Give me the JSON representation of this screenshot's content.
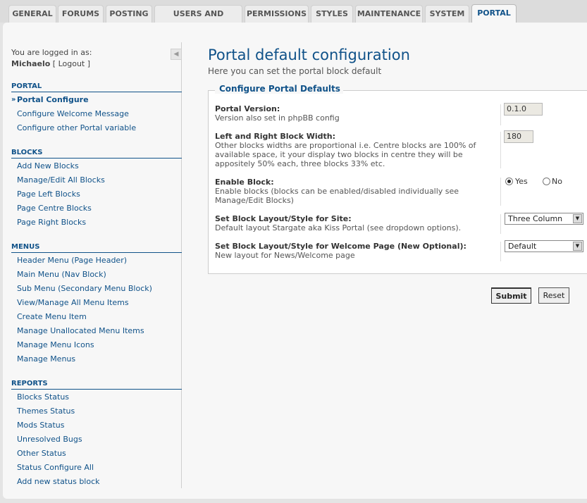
{
  "tabs": [
    {
      "label": "GENERAL"
    },
    {
      "label": "FORUMS"
    },
    {
      "label": "POSTING"
    },
    {
      "label": "USERS AND GROUPS"
    },
    {
      "label": "PERMISSIONS"
    },
    {
      "label": "STYLES"
    },
    {
      "label": "MAINTENANCE"
    },
    {
      "label": "SYSTEM"
    },
    {
      "label": "PORTAL"
    }
  ],
  "login": {
    "label": "You are logged in as:",
    "username": "Michaelo",
    "logout_open": "[",
    "logout": "Logout",
    "logout_close": "]"
  },
  "collapse_icon": "◀",
  "sidebar": {
    "portal": {
      "heading": "PORTAL",
      "items": [
        {
          "label": "Portal Configure"
        },
        {
          "label": "Configure Welcome Message"
        },
        {
          "label": "Configure other Portal variable"
        }
      ]
    },
    "blocks": {
      "heading": "BLOCKS",
      "items": [
        {
          "label": "Add New Blocks"
        },
        {
          "label": "Manage/Edit All Blocks"
        },
        {
          "label": "Page Left Blocks"
        },
        {
          "label": "Page Centre Blocks"
        },
        {
          "label": "Page Right Blocks"
        }
      ]
    },
    "menus": {
      "heading": "MENUS",
      "items": [
        {
          "label": "Header Menu (Page Header)"
        },
        {
          "label": "Main Menu (Nav Block)"
        },
        {
          "label": "Sub Menu (Secondary Menu Block)"
        },
        {
          "label": "View/Manage All Menu Items"
        },
        {
          "label": "Create Menu Item"
        },
        {
          "label": "Manage Unallocated Menu Items"
        },
        {
          "label": "Manage Menu Icons"
        },
        {
          "label": "Manage Menus"
        }
      ]
    },
    "reports": {
      "heading": "REPORTS",
      "items": [
        {
          "label": "Blocks Status"
        },
        {
          "label": "Themes Status"
        },
        {
          "label": "Mods Status"
        },
        {
          "label": "Unresolved Bugs"
        },
        {
          "label": "Other Status"
        },
        {
          "label": "Status Configure All"
        },
        {
          "label": "Add new status block"
        }
      ]
    }
  },
  "page": {
    "title": "Portal default configuration",
    "subtitle": "Here you can set the portal block default"
  },
  "form": {
    "legend": "Configure Portal Defaults",
    "version": {
      "title": "Portal Version:",
      "desc": "Version also set in phpBB config",
      "value": "0.1.0"
    },
    "width": {
      "title": "Left and Right Block Width:",
      "desc": "Other blocks widths are proportional i.e. Centre blocks are 100% of available space, it your display two blocks in centre they will be appositely 50% each, three blocks 33% etc.",
      "value": "180"
    },
    "enable": {
      "title": "Enable Block:",
      "desc": "Enable blocks (blocks can be enabled/disabled individually see Manage/Edit Blocks)",
      "yes_label": "Yes",
      "no_label": "No",
      "selected": "Yes"
    },
    "layout_site": {
      "title": "Set Block Layout/Style for Site:",
      "desc": "Default layout Stargate aka Kiss Portal (see dropdown options).",
      "value": "Three Column"
    },
    "layout_welcome": {
      "title": "Set Block Layout/Style for Welcome Page (New Optional):",
      "desc": "New layout for News/Welcome page",
      "value": "Default"
    }
  },
  "buttons": {
    "submit": "Submit",
    "reset": "Reset"
  },
  "icons": {
    "dropdown": "▼",
    "bullet": "»"
  }
}
